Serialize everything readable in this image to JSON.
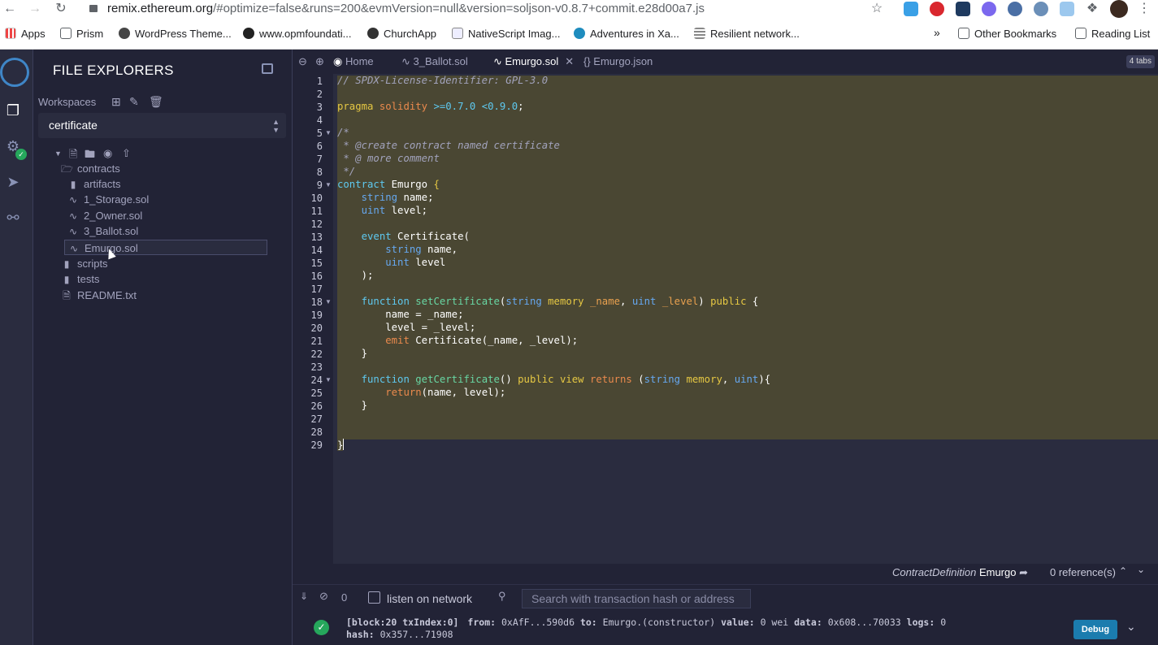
{
  "browser": {
    "url_host": "remix.ethereum.org",
    "url_path": "/#optimize=false&runs=200&evmVersion=null&version=soljson-v0.8.7+commit.e28d00a7.js",
    "bookmarks": [
      {
        "label": "Apps",
        "icon": "apps-grid-icon"
      },
      {
        "label": "Prism",
        "icon": "folder-icon"
      },
      {
        "label": "WordPress Theme...",
        "icon": "wordpress-icon"
      },
      {
        "label": "www.opmfoundati...",
        "icon": "globe-icon"
      },
      {
        "label": "ChurchApp",
        "icon": "churchapp-icon"
      },
      {
        "label": "NativeScript Imag...",
        "icon": "page-icon"
      },
      {
        "label": "Adventures in Xa...",
        "icon": "wordpress-icon"
      },
      {
        "label": "Resilient network...",
        "icon": "lines-icon"
      }
    ],
    "more": "»",
    "other_bookmarks": "Other Bookmarks",
    "reading_list": "Reading List"
  },
  "sidepanel": {
    "title": "FILE EXPLORERS",
    "workspaces_label": "Workspaces",
    "workspace": "certificate",
    "tree": [
      {
        "label": "contracts",
        "type": "folder-open"
      },
      {
        "label": "artifacts",
        "type": "folder"
      },
      {
        "label": "1_Storage.sol",
        "type": "sol"
      },
      {
        "label": "2_Owner.sol",
        "type": "sol"
      },
      {
        "label": "3_Ballot.sol",
        "type": "sol"
      },
      {
        "label": "Emurgo.sol",
        "type": "sol",
        "selected": true
      },
      {
        "label": "scripts",
        "type": "folder"
      },
      {
        "label": "tests",
        "type": "folder"
      },
      {
        "label": "README.txt",
        "type": "file"
      }
    ]
  },
  "tabs": {
    "home": "Home",
    "ballot": "3_Ballot.sol",
    "emurgo_sol": "Emurgo.sol",
    "emurgo_json": "Emurgo.json",
    "count": "4 tabs"
  },
  "editor": {
    "line_count": 29
  },
  "status": {
    "definition_type": "ContractDefinition",
    "definition_name": "Emurgo",
    "references": "0 reference(s)"
  },
  "terminal": {
    "count": "0",
    "listen_label": "listen on network",
    "search_placeholder": "Search with transaction hash or address",
    "log_line1": "[block:20 txIndex:0]",
    "log_from_label": "from:",
    "log_from": "0xAfF...590d6",
    "log_to_label": "to:",
    "log_to": "Emurgo.(constructor)",
    "log_value_label": "value:",
    "log_value": "0 wei",
    "log_data_label": "data:",
    "log_data": "0x608...70033",
    "log_logs_label": "logs:",
    "log_logs": "0",
    "log_hash_label": "hash:",
    "log_hash": "0x357...71908",
    "debug_label": "Debug"
  }
}
